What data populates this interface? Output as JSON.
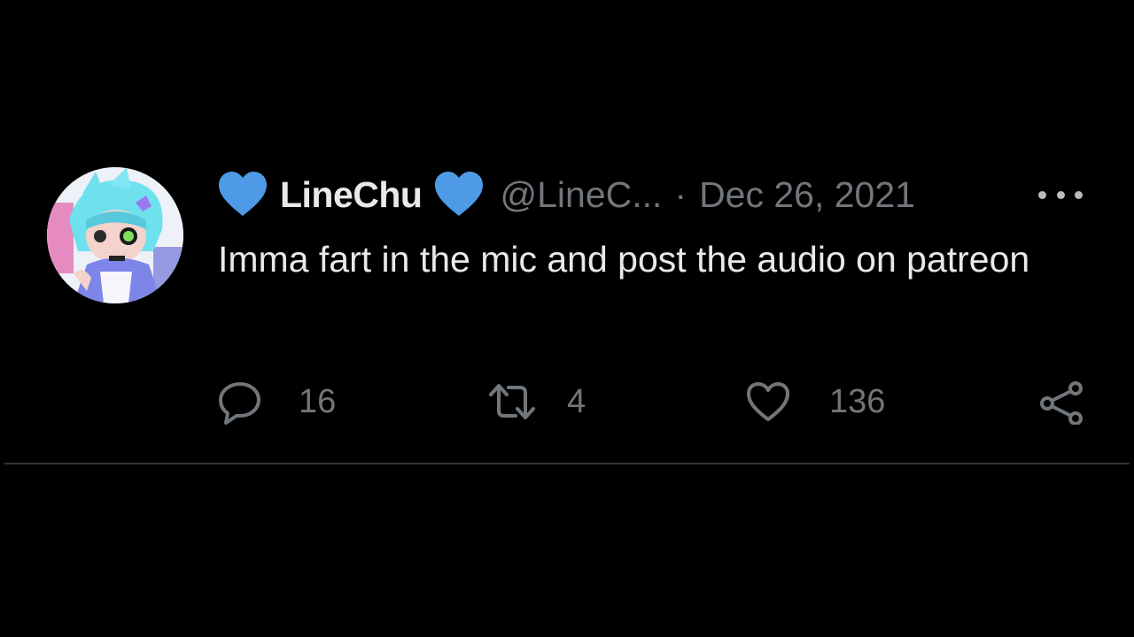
{
  "tweet": {
    "display_name": "LineChu",
    "handle": "@LineC...",
    "separator": "·",
    "date": "Dec 26, 2021",
    "text": "Imma fart in the mic and post the audio on patreon",
    "badge_icon": "blue-heart-icon",
    "badge_color": "#4e9ae6"
  },
  "actions": {
    "reply": {
      "icon": "reply-icon",
      "count": "16"
    },
    "retweet": {
      "icon": "retweet-icon",
      "count": "4"
    },
    "like": {
      "icon": "like-icon",
      "count": "136"
    },
    "share": {
      "icon": "share-icon"
    }
  },
  "colors": {
    "background": "#000000",
    "primary_text": "#e7e9ea",
    "secondary_text": "#71767b",
    "divider": "#2f3336"
  }
}
